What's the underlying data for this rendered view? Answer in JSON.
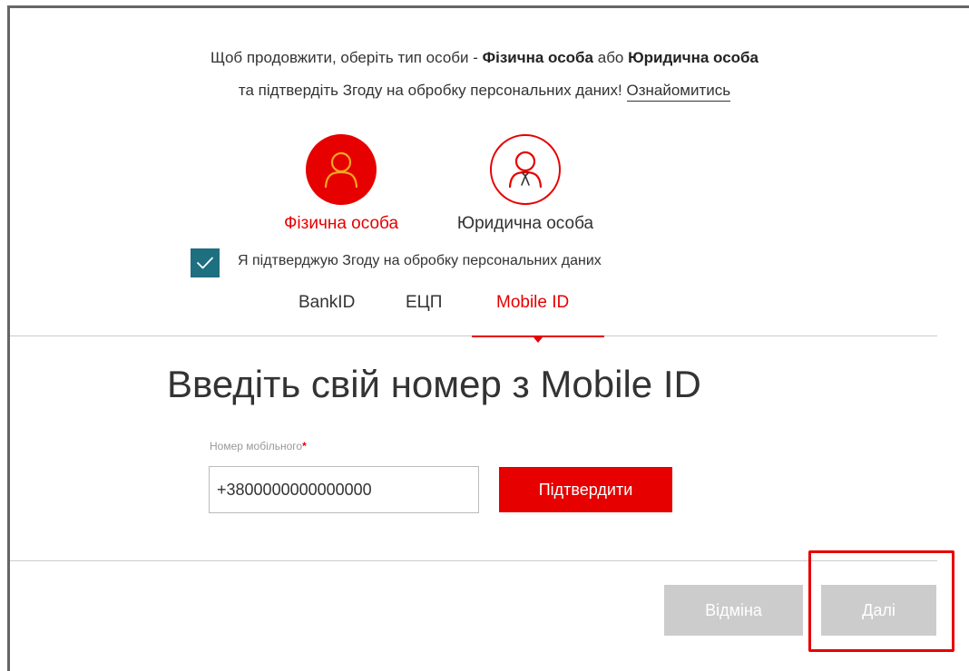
{
  "intro": {
    "line1_prefix": "Щоб продовжити, оберіть тип особи - ",
    "option_individual": "Фізична особа",
    "line1_or": " або ",
    "option_legal": "Юридична особа",
    "line2_text": "та підтвердіть Згоду на обробку персональних даних! ",
    "consent_link": "Ознайомитись"
  },
  "person_types": {
    "individual": {
      "label": "Фізична особа",
      "icon": "person-icon",
      "selected": true
    },
    "legal": {
      "label": "Юридична особа",
      "icon": "person-tie-icon",
      "selected": false
    }
  },
  "consent": {
    "checked": true,
    "label": "Я підтверджую Згоду на обробку персональних даних"
  },
  "tabs": [
    {
      "label": "BankID",
      "active": false
    },
    {
      "label": "ЕЦП",
      "active": false
    },
    {
      "label": "Mobile ID",
      "active": true
    }
  ],
  "mobile_id": {
    "heading": "Введіть свій номер з Mobile ID",
    "phone_label": "Номер мобільного",
    "required_mark": "*",
    "phone_value": "+3800000000000000",
    "confirm_label": "Підтвердити"
  },
  "footer": {
    "cancel_label": "Відміна",
    "next_label": "Далі"
  },
  "colors": {
    "accent": "#e60000",
    "checkbox": "#1e6f80",
    "disabled_button": "#cccccc",
    "text": "#333333"
  }
}
